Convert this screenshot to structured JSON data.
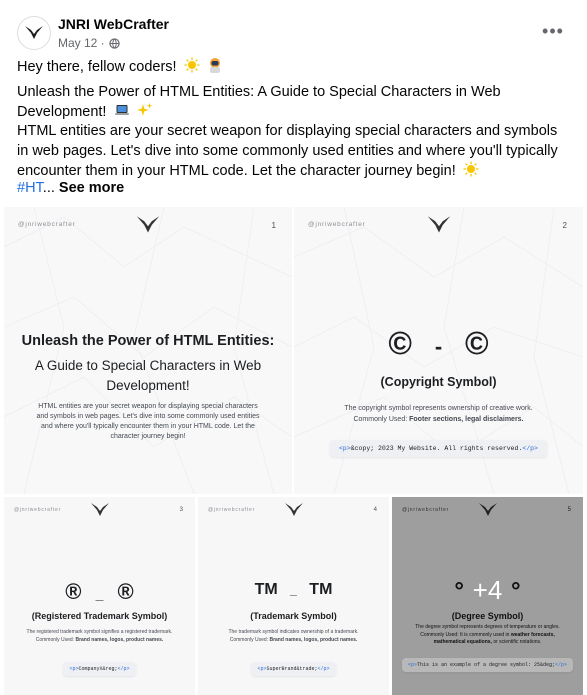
{
  "post": {
    "author": "JNRI WebCrafter",
    "date": "May 12 ·",
    "line1": "Hey there, fellow coders!",
    "line2": "Unleash the Power of HTML Entities: A Guide to Special Characters in Web Development!",
    "line3": "HTML entities are your secret weapon for displaying special characters and symbols in web pages. Let's dive into some commonly used entities and where you'll typically encounter them in your HTML code. Let the character journey begin!",
    "hashtag": "#HT",
    "ellipsis": "...",
    "see_more": "See more",
    "more_icon": "ellipsis-horizontal-icon",
    "privacy_icon": "globe-icon"
  },
  "cards": {
    "c1": {
      "handle": "@jnriwebcrafter",
      "num": "1",
      "title": "Unleash the Power of HTML Entities:",
      "subtitle1": "A Guide to Special Characters in Web",
      "subtitle2": "Development!",
      "para1": "HTML entities are your secret weapon for displaying special characters",
      "para2": "and symbols in web pages. Let's dive into some commonly used entities",
      "para3": "and where you'll typically encounter them in your HTML code. Let the",
      "para4": "character journey begin!"
    },
    "c2": {
      "handle": "@jnriwebcrafter",
      "num": "2",
      "sym_left": "©",
      "dash": "-",
      "sym_right": "©",
      "name": "(Copyright Symbol)",
      "desc": "The copyright symbol represents ownership of creative work.",
      "used_label": "Commonly Used:",
      "used_value": "Footer sections, legal disclaimers.",
      "code_open": "<p>",
      "code_body": "&copy; 2023 My Website. All rights reserved.",
      "code_close": "</p>"
    },
    "c3": {
      "handle": "@jnriwebcrafter",
      "num": "3",
      "sym_left": "®",
      "dash": "_",
      "sym_right": "®",
      "name": "(Registered Trademark Symbol)",
      "desc": "The registered trademark symbol signifies a registered trademark.",
      "used_label": "Commonly Used:",
      "used_value": "Brand names, logos, product names.",
      "code_open": "<p>",
      "code_body": "CompanyX&reg;",
      "code_close": "</p>"
    },
    "c4": {
      "handle": "@jnriwebcrafter",
      "num": "4",
      "sym_left": "TM",
      "dash": "_",
      "sym_right": "TM",
      "name": "(Trademark Symbol)",
      "desc": "The trademark symbol indicates ownership of a trademark.",
      "used_label": "Commonly Used:",
      "used_value": "Brand names, logos, product names.",
      "code_open": "<p>",
      "code_body": "SuperBrand&trade;",
      "code_close": "</p>"
    },
    "c5": {
      "handle": "@jnriwebcrafter",
      "num": "5",
      "sym_left": "°",
      "overlay": "+4",
      "sym_right": "°",
      "name": "(Degree Symbol)",
      "desc": "The degree symbol represents degrees of temperature or angles.",
      "used_label": "Commonly Used: It is commonly used in",
      "used_value": "weather forecasts, mathematical equations,",
      "used_tail": "or scientific notations.",
      "code_open": "<p>",
      "code_body": "This is an example of a degree symbol: 25&deg;",
      "code_close": "</p>"
    }
  }
}
